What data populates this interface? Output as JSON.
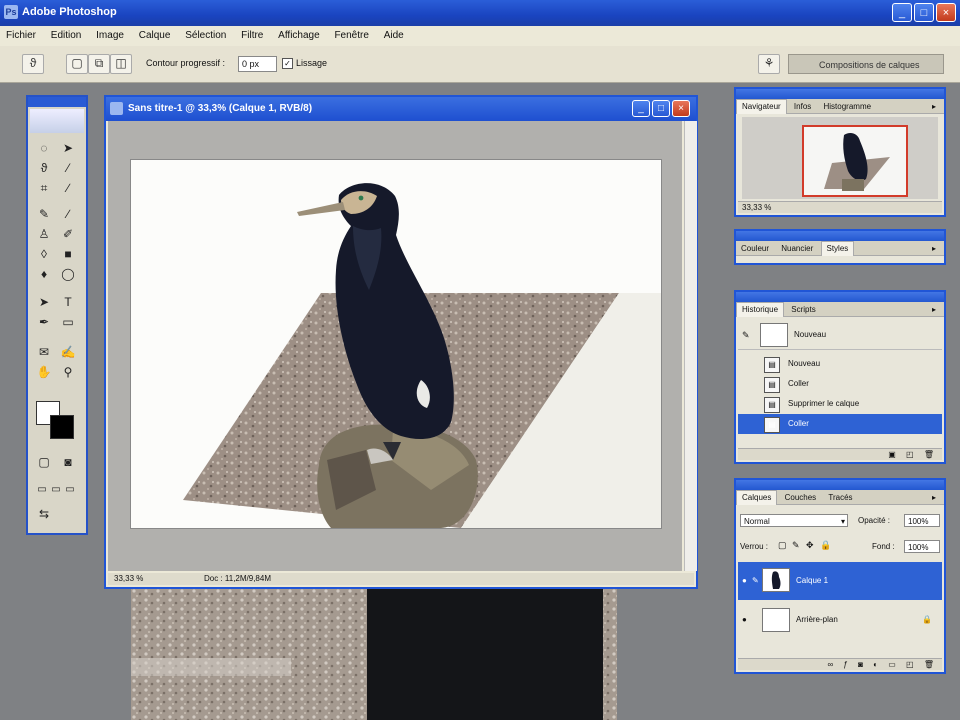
{
  "app": {
    "title": "Adobe Photoshop",
    "icon_name": "photoshop-icon",
    "accent_color": "#1a44c0"
  },
  "menu": [
    "Fichier",
    "Edition",
    "Image",
    "Calque",
    "Sélection",
    "Filtre",
    "Affichage",
    "Fenêtre",
    "Aide"
  ],
  "options_bar": {
    "feather_label": "Contour progressif :",
    "feather_value": "0 px",
    "smooth_label": "Lissage",
    "palette_well_label": "Compositions de calques"
  },
  "document": {
    "title": "Sans titre-1 @ 33,3% (Calque 1, RVB/8)",
    "zoom": "33,33 %",
    "status": "Doc : 11,2M/9,84M"
  },
  "navigator": {
    "tabs": [
      "Navigateur",
      "Infos",
      "Histogramme"
    ],
    "zoom": "33,33 %"
  },
  "color_palette": {
    "tabs": [
      "Couleur",
      "Nuancier",
      "Styles"
    ]
  },
  "history": {
    "tabs": [
      "Historique",
      "Scripts"
    ],
    "snapshot_label": "Nouveau",
    "items": [
      {
        "label": "Nouveau",
        "selected": false
      },
      {
        "label": "Coller",
        "selected": false
      },
      {
        "label": "Supprimer le calque",
        "selected": false
      },
      {
        "label": "Coller",
        "selected": true
      }
    ]
  },
  "layers": {
    "tabs": [
      "Calques",
      "Couches",
      "Tracés"
    ],
    "blend_mode": "Normal",
    "opacity_label": "Opacité :",
    "opacity_value": "100%",
    "lock_label": "Verrou :",
    "fill_label": "Fond :",
    "fill_value": "100%",
    "items": [
      {
        "name": "Calque 1",
        "selected": true
      },
      {
        "name": "Arrière-plan",
        "selected": false,
        "locked": true
      }
    ]
  }
}
